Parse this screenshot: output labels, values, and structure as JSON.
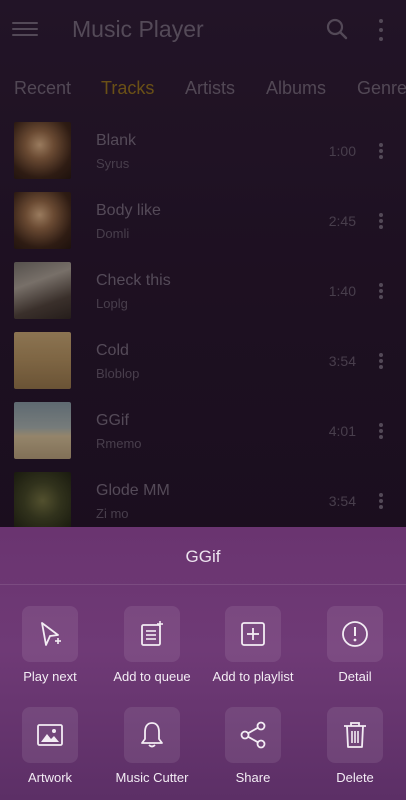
{
  "header": {
    "title": "Music Player"
  },
  "tabs": [
    {
      "label": "Recent"
    },
    {
      "label": "Tracks"
    },
    {
      "label": "Artists"
    },
    {
      "label": "Albums"
    },
    {
      "label": "Genre"
    }
  ],
  "active_tab": "Tracks",
  "tracks": [
    {
      "title": "Blank",
      "artist": "Syrus",
      "duration": "1:00"
    },
    {
      "title": "Body like",
      "artist": "Domli",
      "duration": "2:45"
    },
    {
      "title": "Check this",
      "artist": "Loplg",
      "duration": "1:40"
    },
    {
      "title": "Cold",
      "artist": "Bloblop",
      "duration": "3:54"
    },
    {
      "title": "GGif",
      "artist": "Rmemo",
      "duration": "4:01"
    },
    {
      "title": "Glode MM",
      "artist": "Zi mo",
      "duration": "3:54"
    }
  ],
  "sheet": {
    "title": "GGif",
    "actions": [
      {
        "label": "Play next",
        "icon": "play-next-icon"
      },
      {
        "label": "Add to queue",
        "icon": "add-to-queue-icon"
      },
      {
        "label": "Add to playlist",
        "icon": "add-to-playlist-icon"
      },
      {
        "label": "Detail",
        "icon": "info-icon"
      },
      {
        "label": "Artwork",
        "icon": "image-icon"
      },
      {
        "label": "Music Cutter",
        "icon": "bell-icon"
      },
      {
        "label": "Share",
        "icon": "share-icon"
      },
      {
        "label": "Delete",
        "icon": "trash-icon"
      }
    ]
  },
  "colors": {
    "accent_tab": "#8a6a1a",
    "sheet_background": "#6a3470",
    "app_background": "#231428"
  }
}
